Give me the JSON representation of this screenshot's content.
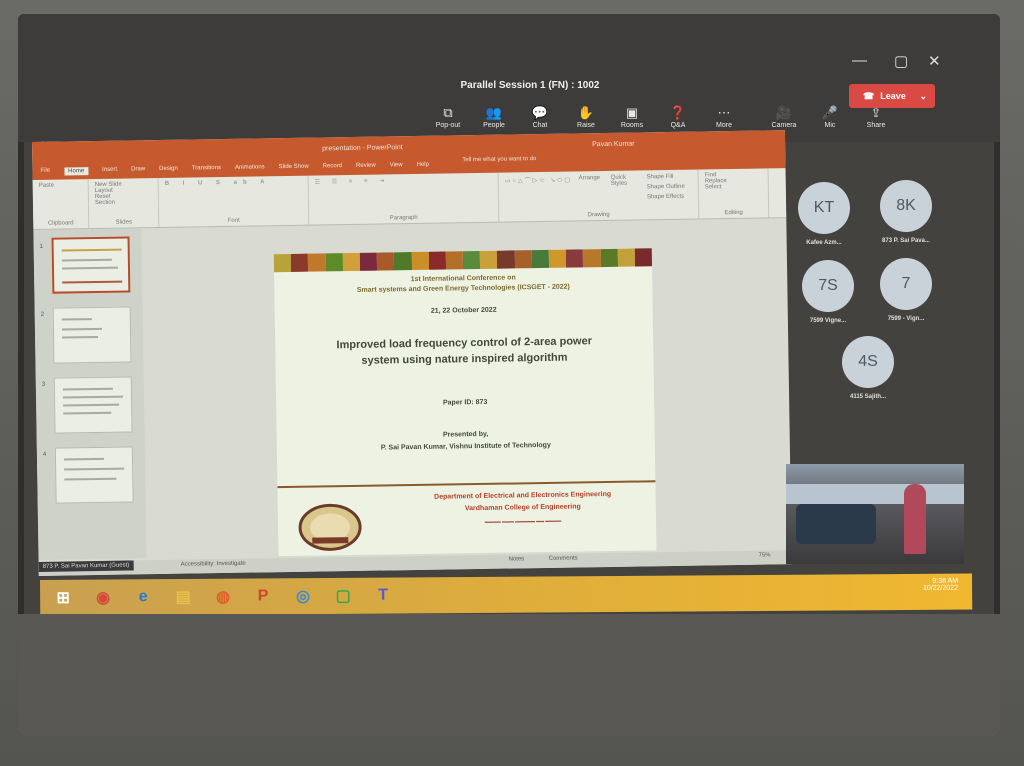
{
  "meeting": {
    "title": "Parallel Session 1 (FN) : 1002",
    "toolbar": [
      {
        "label": "Pop-out",
        "icon": "pop-out-icon",
        "glyph": "⧉"
      },
      {
        "label": "People",
        "icon": "people-icon",
        "glyph": "👥"
      },
      {
        "label": "Chat",
        "icon": "chat-icon",
        "glyph": "💬"
      },
      {
        "label": "Raise",
        "icon": "hand-icon",
        "glyph": "✋"
      },
      {
        "label": "Rooms",
        "icon": "rooms-icon",
        "glyph": "▣"
      },
      {
        "label": "Q&A",
        "icon": "qa-icon",
        "glyph": "❓"
      },
      {
        "label": "More",
        "icon": "more-icon",
        "glyph": "⋯"
      },
      {
        "label": "Camera",
        "icon": "camera-icon",
        "glyph": "🎥"
      },
      {
        "label": "Mic",
        "icon": "mic-icon",
        "glyph": "🎤"
      },
      {
        "label": "Share",
        "icon": "share-icon",
        "glyph": "⇪"
      }
    ],
    "leave_label": "Leave",
    "leave_color": "#d94a45"
  },
  "powerpoint": {
    "doc_title": "presentation - PowerPoint",
    "user_name": "Pavan Kumar",
    "tabs": [
      "File",
      "Home",
      "Insert",
      "Draw",
      "Design",
      "Transitions",
      "Animations",
      "Slide Show",
      "Record",
      "Review",
      "View",
      "Help"
    ],
    "tell_me": "Tell me what you want to do",
    "ribbon_groups": [
      "Clipboard",
      "Slides",
      "Font",
      "Paragraph",
      "Drawing",
      "Editing"
    ],
    "ribbon_buttons": {
      "paste": "Paste",
      "new_slide": "New Slide",
      "layout": "Layout",
      "reset": "Reset",
      "section": "Section",
      "arrange": "Arrange",
      "quick_styles": "Quick Styles",
      "shape_fill": "Shape Fill",
      "shape_outline": "Shape Outline",
      "shape_effects": "Shape Effects",
      "find": "Find",
      "replace": "Replace",
      "select": "Select"
    },
    "status_name": "873 P. Sai Pavan Kumar (Guest)",
    "status_notes": "Notes",
    "status_comments": "Comments",
    "accessibility": "Accessibility: Investigate",
    "zoom": "75%"
  },
  "slide": {
    "conference_line1": "1st International Conference on",
    "conference_line2": "Smart systems and Green Energy Technologies (ICSGET - 2022)",
    "dates": "21, 22 October 2022",
    "paper_title": "Improved load frequency control of 2-area power system using nature inspired algorithm",
    "paper_id": "Paper ID: 873",
    "presented_by": "Presented by,",
    "presenter": "P. Sai Pavan Kumar, Vishnu Institute of Technology",
    "department": "Department of Electrical and Electronics Engineering",
    "college": "Vardhaman College of Engineering",
    "stripe_colors": [
      "#b8a23a",
      "#8a3a2a",
      "#c2782a",
      "#5f8a2a",
      "#d1a03a",
      "#7a2a3a",
      "#a85a2a",
      "#4e7a2a",
      "#c9902a",
      "#8a2a2a",
      "#b0702a",
      "#5a8a3a",
      "#caa03a",
      "#7a3a2a",
      "#a8602a",
      "#4a7a3a",
      "#d0982a",
      "#8a3a3a",
      "#b8782a",
      "#5a7a2a",
      "#c2a03a",
      "#7a2a2a"
    ]
  },
  "participants": [
    {
      "initials": "KT",
      "name": "Kafee Azm..."
    },
    {
      "initials": "8K",
      "name": "873 P. Sai Pava..."
    },
    {
      "initials": "7S",
      "name": "7599 Vigne..."
    },
    {
      "initials": "7",
      "name": "7599 - Vign..."
    },
    {
      "initials": "4S",
      "name": "4115 Sajith..."
    }
  ],
  "taskbar": {
    "apps": [
      {
        "icon": "windows-start-icon",
        "glyph": "⊞",
        "color": "#ffffff"
      },
      {
        "icon": "chrome-icon",
        "glyph": "◉",
        "color": "#d44a3a"
      },
      {
        "icon": "edge-icon",
        "glyph": "e",
        "color": "#2a7ad4"
      },
      {
        "icon": "file-explorer-icon",
        "glyph": "▤",
        "color": "#e6c04a"
      },
      {
        "icon": "firefox-icon",
        "glyph": "◍",
        "color": "#e0602a"
      },
      {
        "icon": "powerpoint-icon",
        "glyph": "P",
        "color": "#c84a2a"
      },
      {
        "icon": "globe-icon",
        "glyph": "◎",
        "color": "#3a8ad0"
      },
      {
        "icon": "green-app-icon",
        "glyph": "▢",
        "color": "#3aa84a"
      },
      {
        "icon": "teams-icon",
        "glyph": "T",
        "color": "#5a5ad0"
      }
    ],
    "time": "9:38 AM",
    "date": "10/22/2022"
  }
}
